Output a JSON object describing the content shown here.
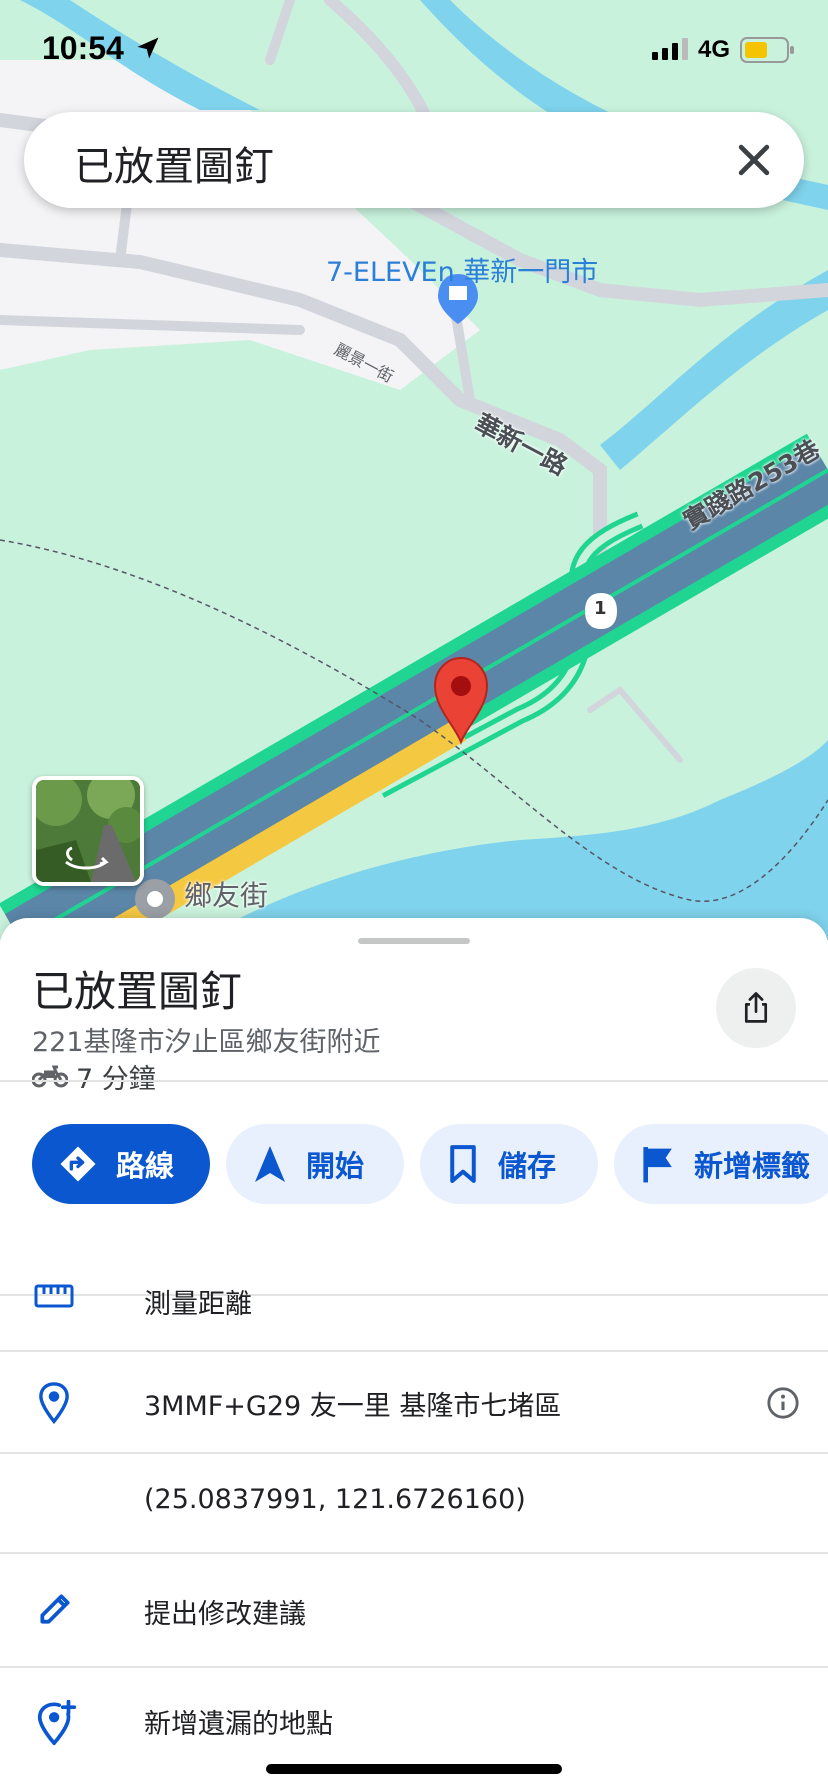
{
  "status_bar": {
    "time": "10:54",
    "network": "4G",
    "battery_color": "#f5c400"
  },
  "search": {
    "text": "已放置圖釘"
  },
  "map": {
    "poi_name": "7-ELEVEn 華新一門市",
    "road_labels": [
      "麗景一街",
      "華新一路",
      "實踐路253巷"
    ],
    "route_shield": "1",
    "street_name": "鄉友街",
    "colors": {
      "land": "#c9f2dd",
      "water": "#7fd3ec",
      "highway_border": "#1fd591",
      "highway_fill": "#5b86a8",
      "highlight_road": "#f5c842",
      "pin": "#ea4335"
    }
  },
  "place": {
    "title": "已放置圖釘",
    "address": "221基隆市汐止區鄉友街附近",
    "travel_time": "7 分鐘",
    "travel_mode_icon": "motorcycle-icon"
  },
  "actions": [
    {
      "label": "路線",
      "icon": "directions-icon"
    },
    {
      "label": "開始",
      "icon": "navigation-icon"
    },
    {
      "label": "儲存",
      "icon": "bookmark-icon"
    },
    {
      "label": "新增標籤",
      "icon": "flag-icon"
    }
  ],
  "details": {
    "measure": "測量距離",
    "plus_code": "3MMF+G29 友一里 基隆市七堵區",
    "coordinates": "(25.0837991, 121.6726160)",
    "suggest_edit": "提出修改建議",
    "add_missing": "新增遺漏的地點"
  },
  "accent_color": "#0b57d0"
}
